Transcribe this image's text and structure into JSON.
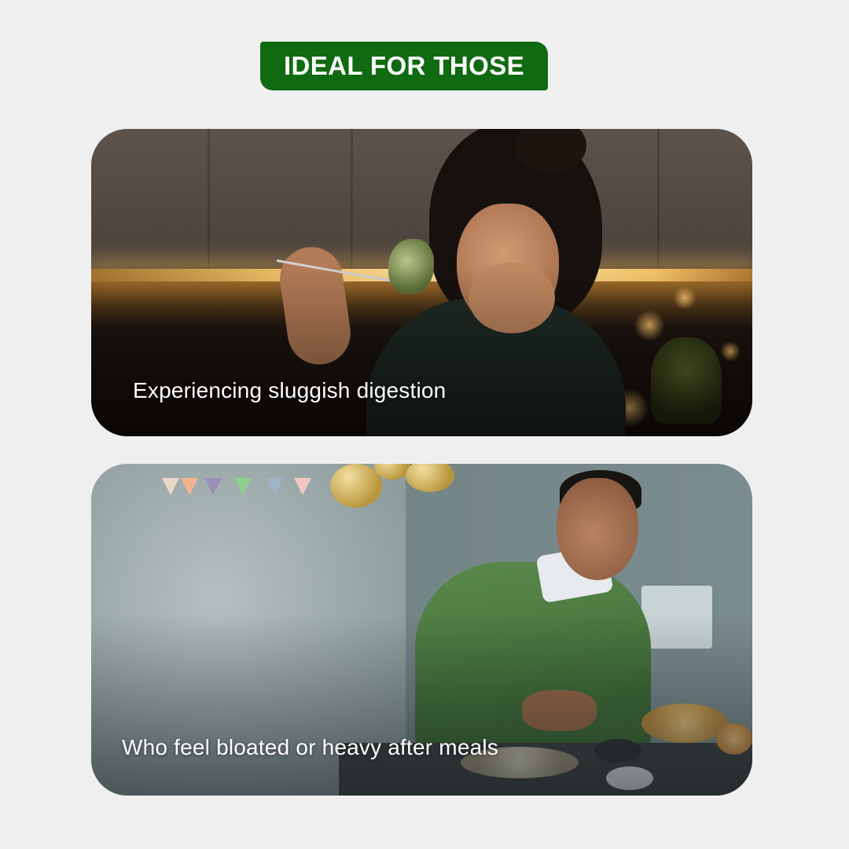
{
  "badge": {
    "label": "IDEAL FOR THOSE"
  },
  "colors": {
    "background": "#efefef",
    "badge": "#0f6a12",
    "caption": "#ffffff"
  },
  "cards": [
    {
      "caption": "Experiencing sluggish digestion"
    },
    {
      "caption": "Who feel bloated or heavy after meals"
    }
  ]
}
